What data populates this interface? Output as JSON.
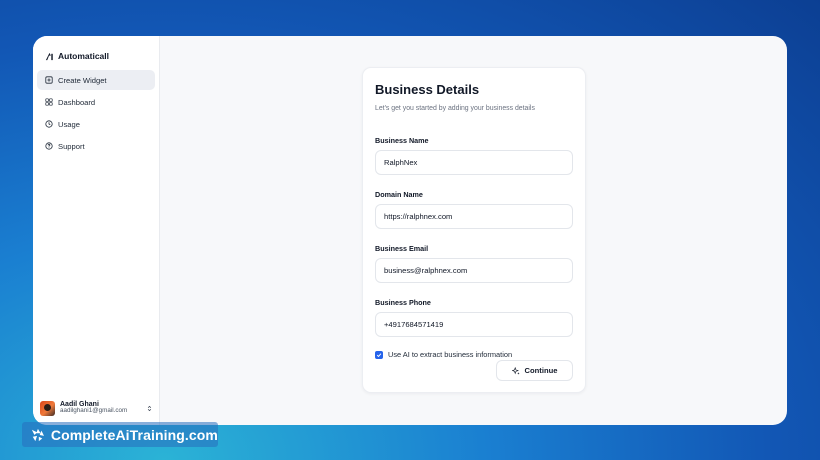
{
  "app": {
    "name": "Automaticall"
  },
  "sidebar": {
    "items": [
      {
        "label": "Create Widget",
        "icon": "plus-square-icon",
        "active": true
      },
      {
        "label": "Dashboard",
        "icon": "grid-icon",
        "active": false
      },
      {
        "label": "Usage",
        "icon": "clock-icon",
        "active": false
      },
      {
        "label": "Support",
        "icon": "help-circle-icon",
        "active": false
      }
    ],
    "user": {
      "name": "Aadil Ghani",
      "email": "aadilghani1@gmail.com"
    }
  },
  "form": {
    "title": "Business Details",
    "subtitle": "Let's get you started by adding your business details",
    "fields": [
      {
        "label": "Business Name",
        "value": "RalphNex"
      },
      {
        "label": "Domain Name",
        "value": "https://ralphnex.com"
      },
      {
        "label": "Business Email",
        "value": "business@ralphnex.com"
      },
      {
        "label": "Business Phone",
        "value": "+4917684571419"
      }
    ],
    "ai_checkbox": {
      "label": "Use AI to extract business information",
      "checked": true
    },
    "continue_label": "Continue"
  },
  "watermark": {
    "text": "CompleteAiTraining.com"
  },
  "colors": {
    "accent": "#2563eb",
    "background_gradient": [
      "#2bb3d6",
      "#1257b5"
    ]
  }
}
